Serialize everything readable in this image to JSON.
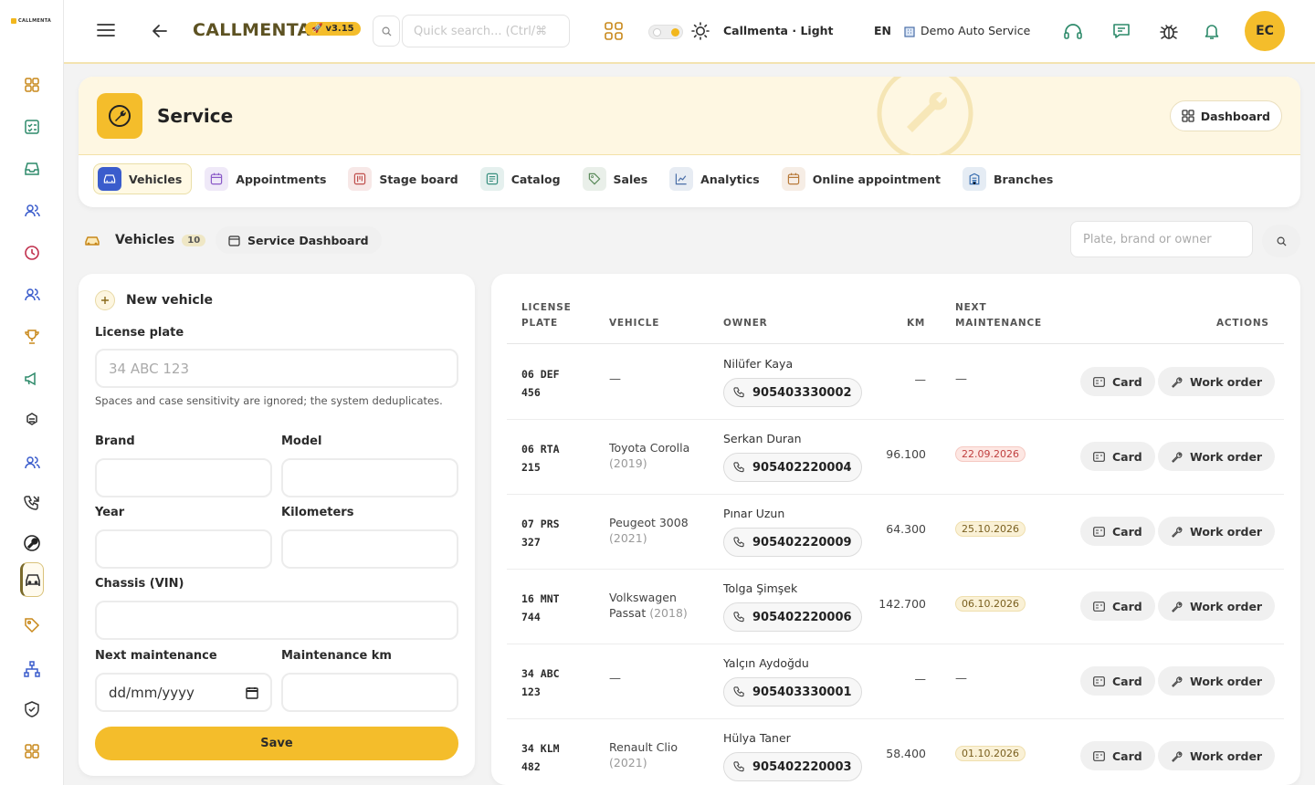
{
  "app": {
    "logo_text": "CALLMENTA",
    "brand": "CALLMENTA",
    "version": "v3.15"
  },
  "topbar": {
    "search_placeholder": "Quick search... (Ctrl/⌘",
    "theme_label": "Callmenta · Light",
    "language": "EN",
    "company": "Demo Auto Service",
    "avatar_initials": "EC"
  },
  "sidebar": {
    "icons": [
      "dashboard-icon",
      "checklist-icon",
      "inbox-icon",
      "users-icon",
      "clock-icon",
      "contacts-icon",
      "trophy-icon",
      "megaphone-icon",
      "integrations-icon",
      "team-icon",
      "call-log-icon",
      "service-icon",
      "vehicles-icon",
      "tag-icon",
      "org-chart-icon",
      "shield-icon",
      "apps-icon"
    ]
  },
  "service": {
    "title": "Service",
    "dashboard_button": "Dashboard",
    "tabs": [
      {
        "label": "Vehicles",
        "icon": "car-icon",
        "color": "#3a5ccc"
      },
      {
        "label": "Appointments",
        "icon": "calendar-icon",
        "color": "#8a5ac8"
      },
      {
        "label": "Stage board",
        "icon": "board-icon",
        "color": "#c0504d"
      },
      {
        "label": "Catalog",
        "icon": "catalog-icon",
        "color": "#3a9080"
      },
      {
        "label": "Sales",
        "icon": "tag-icon",
        "color": "#5a8a5a"
      },
      {
        "label": "Analytics",
        "icon": "chart-icon",
        "color": "#4a6fa8"
      },
      {
        "label": "Online appointment",
        "icon": "calendar-icon",
        "color": "#b87a3a"
      },
      {
        "label": "Branches",
        "icon": "building-icon",
        "color": "#3a6fb0"
      }
    ]
  },
  "subnav": {
    "vehicles_label": "Vehicles",
    "vehicles_count": "10",
    "service_dashboard": "Service Dashboard",
    "plate_search_placeholder": "Plate, brand or owner"
  },
  "form": {
    "title": "New vehicle",
    "license_plate_label": "License plate",
    "license_plate_placeholder": "34 ABC 123",
    "hint": "Spaces and case sensitivity are ignored; the system deduplicates.",
    "brand_label": "Brand",
    "model_label": "Model",
    "year_label": "Year",
    "km_label": "Kilometers",
    "vin_label": "Chassis (VIN)",
    "next_maintenance_label": "Next maintenance",
    "next_maintenance_placeholder": "dd/mm/yyyy",
    "maintenance_km_label": "Maintenance km",
    "save_label": "Save"
  },
  "table": {
    "headers": {
      "plate_1": "LICENSE",
      "plate_2": "PLATE",
      "vehicle": "VEHICLE",
      "owner": "OWNER",
      "km": "KM",
      "next_1": "NEXT",
      "next_2": "MAINTENANCE",
      "actions": "ACTIONS"
    },
    "card_label": "Card",
    "work_order_label": "Work order",
    "rows": [
      {
        "plate_1": "06 DEF",
        "plate_2": "456",
        "vehicle": "—",
        "vehicle_year": "",
        "owner": "Nilüfer Kaya",
        "phone": "905403330002",
        "km": "—",
        "next": "—",
        "status": ""
      },
      {
        "plate_1": "06 RTA",
        "plate_2": "215",
        "vehicle": "Toyota Corolla",
        "vehicle_year": "(2019)",
        "owner": "Serkan Duran",
        "phone": "905402220004",
        "km": "96.100",
        "next": "22.09.2026",
        "status": "warn"
      },
      {
        "plate_1": "07 PRS",
        "plate_2": "327",
        "vehicle": "Peugeot 3008",
        "vehicle_year": "(2021)",
        "owner": "Pınar Uzun",
        "phone": "905402220009",
        "km": "64.300",
        "next": "25.10.2026",
        "status": "ok"
      },
      {
        "plate_1": "16 MNT",
        "plate_2": "744",
        "vehicle": "Volkswagen Passat",
        "vehicle_year": "(2018)",
        "owner": "Tolga Şimşek",
        "phone": "905402220006",
        "km": "142.700",
        "next": "06.10.2026",
        "status": "ok"
      },
      {
        "plate_1": "34 ABC",
        "plate_2": "123",
        "vehicle": "—",
        "vehicle_year": "",
        "owner": "Yalçın Aydoğdu",
        "phone": "905403330001",
        "km": "—",
        "next": "—",
        "status": ""
      },
      {
        "plate_1": "34 KLM",
        "plate_2": "482",
        "vehicle": "Renault Clio",
        "vehicle_year": "(2021)",
        "owner": "Hülya Taner",
        "phone": "905402220003",
        "km": "58.400",
        "next": "01.10.2026",
        "status": "ok"
      }
    ]
  }
}
